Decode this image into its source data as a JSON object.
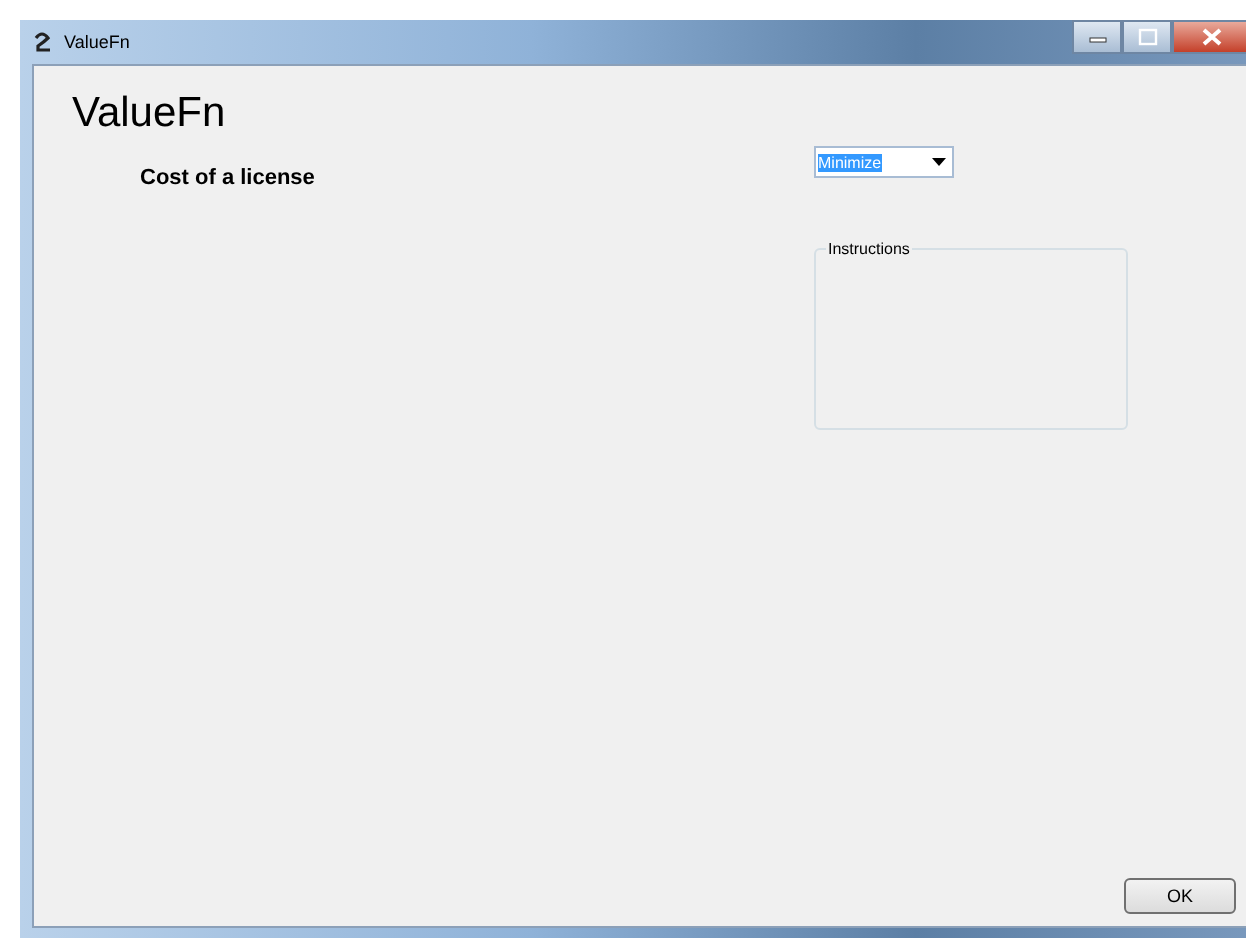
{
  "window": {
    "title": "ValueFn"
  },
  "heading": "ValueFn",
  "criterion": {
    "label": "Cost of a license",
    "direction": "Minimize",
    "text_selected": true
  },
  "instructions": {
    "title": "Instructions"
  },
  "buttons": [
    "OK"
  ]
}
